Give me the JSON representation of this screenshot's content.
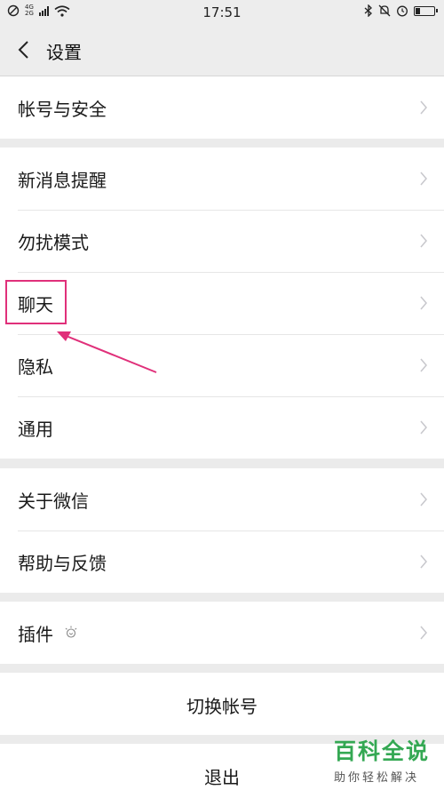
{
  "status_bar": {
    "net_top": "4G",
    "net_bottom": "2G",
    "time": "17:51"
  },
  "header": {
    "title": "设置"
  },
  "groups": [
    {
      "items": [
        {
          "label": "帐号与安全"
        }
      ]
    },
    {
      "items": [
        {
          "label": "新消息提醒"
        },
        {
          "label": "勿扰模式"
        },
        {
          "label": "聊天"
        },
        {
          "label": "隐私"
        },
        {
          "label": "通用"
        }
      ]
    },
    {
      "items": [
        {
          "label": "关于微信"
        },
        {
          "label": "帮助与反馈"
        }
      ]
    },
    {
      "items": [
        {
          "label": "插件"
        }
      ]
    }
  ],
  "actions": {
    "switch_account": "切换帐号",
    "logout": "退出"
  },
  "annotation": {
    "highlight_color": "#e0307a",
    "highlighted_item": "聊天"
  },
  "watermark": {
    "title": "百科全说",
    "subtitle": "助你轻松解决",
    "color": "#34a853"
  }
}
